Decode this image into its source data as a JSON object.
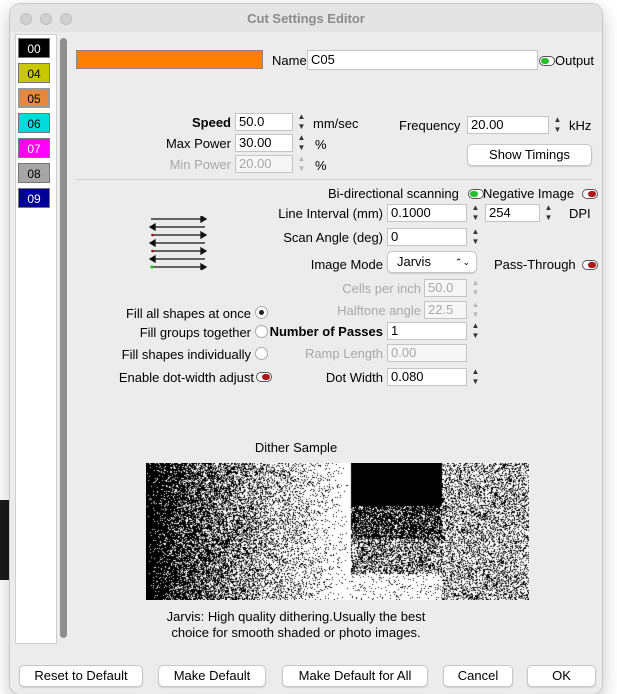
{
  "window": {
    "title": "Cut Settings Editor"
  },
  "layers": [
    {
      "label": "00",
      "bg": "#000000",
      "fg": "#ffffff",
      "selected": false
    },
    {
      "label": "04",
      "bg": "#c8c800",
      "fg": "#000000",
      "selected": false
    },
    {
      "label": "05",
      "bg": "#e8883c",
      "fg": "#000000",
      "selected": true
    },
    {
      "label": "06",
      "bg": "#00dcdc",
      "fg": "#000000",
      "selected": false
    },
    {
      "label": "07",
      "bg": "#ff00ff",
      "fg": "#ffffff",
      "selected": false
    },
    {
      "label": "08",
      "bg": "#a6a6a6",
      "fg": "#000000",
      "selected": false
    },
    {
      "label": "09",
      "bg": "#000096",
      "fg": "#ffffff",
      "selected": false
    }
  ],
  "layer_color": "#ff8000",
  "name": {
    "label": "Name",
    "value": "C05"
  },
  "output": {
    "label": "Output",
    "on": true
  },
  "speed": {
    "label": "Speed",
    "value": "50.0",
    "unit": "mm/sec"
  },
  "max_power": {
    "label": "Max Power",
    "value": "30.00",
    "unit": "%"
  },
  "min_power": {
    "label": "Min Power",
    "value": "20.00",
    "unit": "%"
  },
  "frequency": {
    "label": "Frequency",
    "value": "20.00",
    "unit": "kHz"
  },
  "show_timings": "Show Timings",
  "bidirectional": {
    "label": "Bi-directional scanning",
    "on": true
  },
  "negative_image": {
    "label": "Negative Image",
    "on": false
  },
  "line_interval": {
    "label": "Line Interval (mm)",
    "value": "0.1000",
    "dpi_value": "254",
    "dpi_label": "DPI"
  },
  "scan_angle": {
    "label": "Scan Angle (deg)",
    "value": "0"
  },
  "image_mode": {
    "label": "Image Mode",
    "value": "Jarvis"
  },
  "pass_through": {
    "label": "Pass-Through",
    "on": false
  },
  "cells_per_inch": {
    "label": "Cells per inch",
    "value": "50.0"
  },
  "halftone_angle": {
    "label": "Halftone angle",
    "value": "22.5"
  },
  "fill": {
    "all_at_once": "Fill all shapes at once",
    "groups_together": "Fill groups together",
    "individually": "Fill shapes individually",
    "selected": "all_at_once"
  },
  "num_passes": {
    "label": "Number of Passes",
    "value": "1"
  },
  "ramp_length": {
    "label": "Ramp Length",
    "value": "0.00"
  },
  "dot_width_adjust": {
    "label": "Enable dot-width adjust",
    "on": false
  },
  "dot_width": {
    "label": "Dot Width",
    "value": "0.080"
  },
  "dither": {
    "title": "Dither Sample",
    "description_line1": "Jarvis: High quality dithering.Usually the best",
    "description_line2": "choice for smooth shaded or photo images."
  },
  "footer": {
    "reset": "Reset to Default",
    "make_default": "Make Default",
    "make_default_all": "Make Default for All",
    "cancel": "Cancel",
    "ok": "OK"
  },
  "colors": {
    "toggle_on": "#22c02a",
    "toggle_off": "#b01818"
  }
}
